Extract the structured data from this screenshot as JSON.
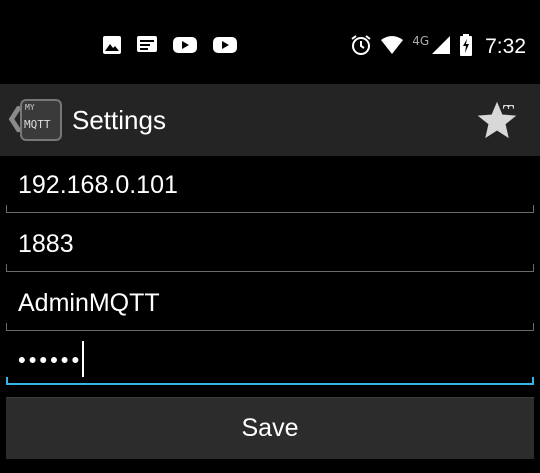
{
  "status_bar": {
    "notification_icons": [
      "image-icon",
      "message-icon",
      "youtube-icon",
      "youtube-icon"
    ],
    "system_icons": [
      "alarm-icon",
      "wifi-icon",
      "cell-signal-icon",
      "battery-charging-icon"
    ],
    "network_type": "4G",
    "time": "7:32"
  },
  "action_bar": {
    "back_glyph": "❮",
    "app_icon": {
      "line1": "MY",
      "line2": "MQTT"
    },
    "title": "Settings",
    "action_icon": "star-icon"
  },
  "form": {
    "fields": [
      {
        "name": "host-field",
        "value": "192.168.0.101"
      },
      {
        "name": "port-field",
        "value": "1883"
      },
      {
        "name": "username-field",
        "value": "AdminMQTT"
      },
      {
        "name": "password-field",
        "value": "••••••",
        "focused": true
      }
    ],
    "save_label": "Save"
  },
  "colors": {
    "background": "#000000",
    "action_bar": "#242424",
    "accent_focus": "#33b5e5",
    "button": "#2c2c2c"
  }
}
